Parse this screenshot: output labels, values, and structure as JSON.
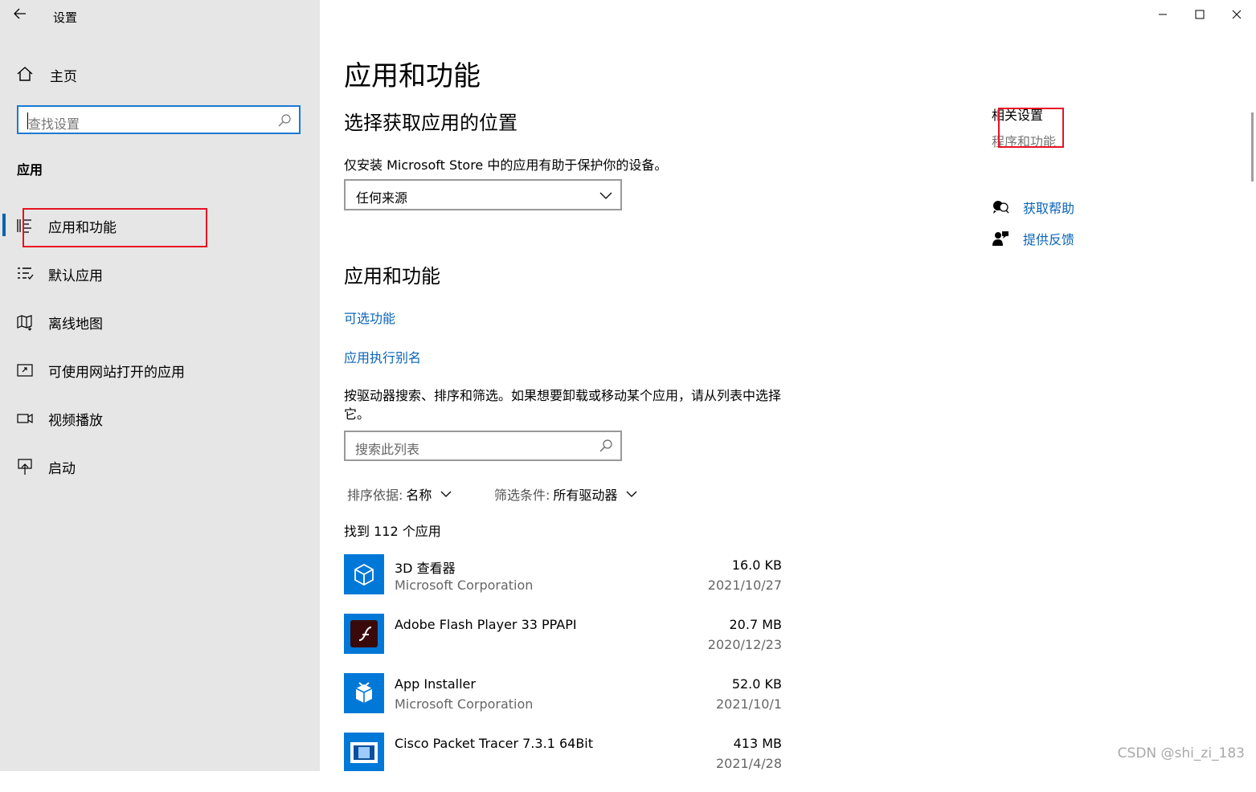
{
  "window": {
    "title": "设置",
    "back_icon": "back-arrow-icon",
    "controls": [
      "minimize-icon",
      "maximize-icon",
      "close-icon"
    ]
  },
  "sidebar": {
    "home_label": "主页",
    "search_placeholder": "查找设置",
    "section_title": "应用",
    "items": [
      {
        "label": "应用和功能",
        "icon": "apps-list-icon",
        "selected": true
      },
      {
        "label": "默认应用",
        "icon": "default-apps-icon"
      },
      {
        "label": "离线地图",
        "icon": "map-icon"
      },
      {
        "label": "可使用网站打开的应用",
        "icon": "web-app-icon"
      },
      {
        "label": "视频播放",
        "icon": "video-icon"
      },
      {
        "label": "启动",
        "icon": "startup-icon"
      }
    ]
  },
  "main": {
    "title": "应用和功能",
    "install_section": {
      "heading": "选择获取应用的位置",
      "description": "仅安装 Microsoft Store 中的应用有助于保护你的设备。",
      "dropdown_value": "任何来源"
    },
    "apps_section": {
      "heading": "应用和功能",
      "link_optional": "可选功能",
      "link_alias": "应用执行别名",
      "description": "按驱动器搜索、排序和筛选。如果想要卸载或移动某个应用，请从列表中选择它。",
      "search_placeholder": "搜索此列表",
      "sort_label": "排序依据:",
      "sort_value": "名称",
      "filter_label": "筛选条件:",
      "filter_value": "所有驱动器",
      "found_text": "找到 112 个应用",
      "apps": [
        {
          "name": "3D 查看器",
          "publisher": "Microsoft Corporation",
          "size": "16.0 KB",
          "date": "2021/10/27",
          "icon": "cube-icon"
        },
        {
          "name": "Adobe Flash Player 33 PPAPI",
          "publisher": "",
          "size": "20.7 MB",
          "date": "2020/12/23",
          "icon": "flash-icon"
        },
        {
          "name": "App Installer",
          "publisher": "Microsoft Corporation",
          "size": "52.0 KB",
          "date": "2021/10/1",
          "icon": "package-icon"
        },
        {
          "name": "Cisco Packet Tracer 7.3.1 64Bit",
          "publisher": "",
          "size": "413 MB",
          "date": "2021/4/28",
          "icon": "packet-tracer-icon"
        }
      ]
    }
  },
  "related": {
    "heading": "相关设置",
    "link": "程序和功能",
    "help_label": "获取帮助",
    "feedback_label": "提供反馈"
  },
  "watermark": "CSDN @shi_zi_183",
  "colors": {
    "sidebar_bg": "#e6e6e6",
    "accent": "#0063b1",
    "link": "#0a64b8",
    "annotation_red": "#e81123"
  }
}
